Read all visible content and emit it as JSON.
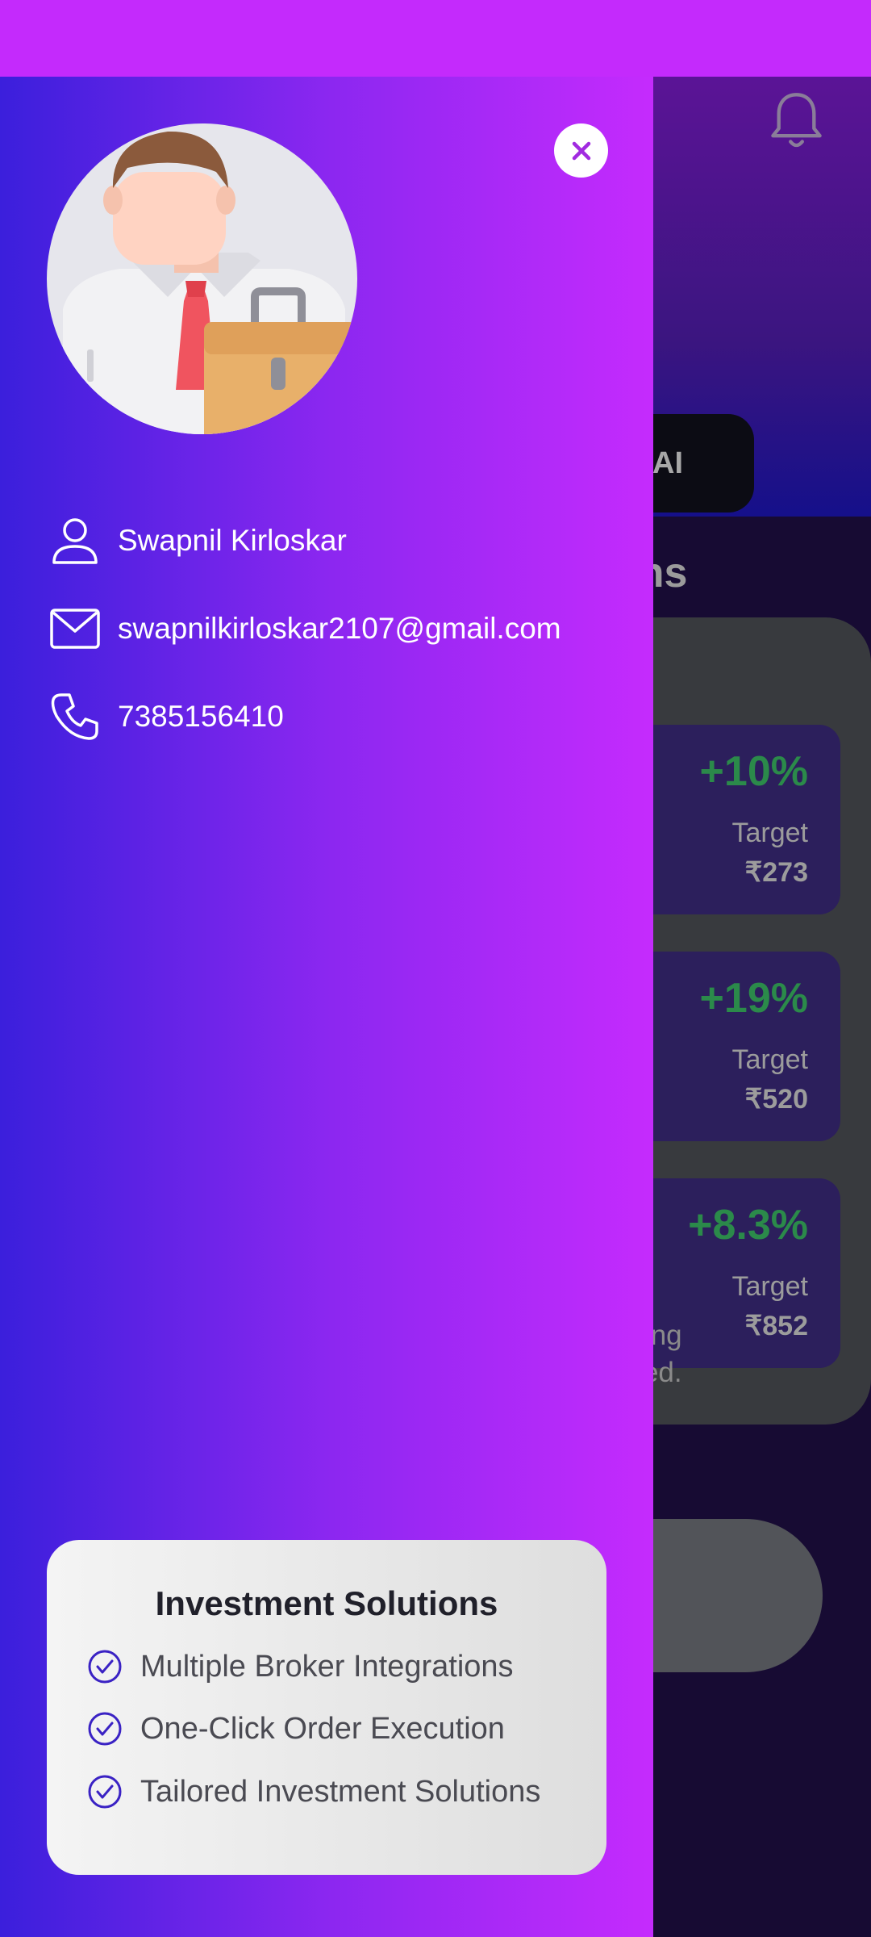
{
  "background_app": {
    "chip_label": "AI",
    "section_title_partial": "ons",
    "cards": [
      {
        "percent": "+10%",
        "target_label": "Target",
        "target_value": "₹273"
      },
      {
        "percent": "+19%",
        "target_label": "Target",
        "target_value": "₹520"
      },
      {
        "percent": "+8.3%",
        "target_label": "Target",
        "target_value": "₹852"
      }
    ],
    "disclaimer_line1": "along",
    "disclaimer_line2": "aced."
  },
  "drawer": {
    "user": {
      "name": "Swapnil Kirloskar",
      "email": "swapnilkirloskar2107@gmail.com",
      "phone": "7385156410"
    },
    "solutions": {
      "title": "Investment Solutions",
      "items": [
        "Multiple Broker Integrations",
        "One-Click Order Execution",
        "Tailored Investment Solutions"
      ]
    }
  },
  "colors": {
    "status_bar": "#c42afc",
    "drawer_gradient_start": "#3b1fdc",
    "drawer_gradient_end": "#c52bfd",
    "positive_green": "#2b8a4a",
    "check_icon": "#3a22c4"
  },
  "icons": [
    "bell-icon",
    "close-icon",
    "user-icon",
    "mail-icon",
    "phone-icon",
    "check-circle-icon"
  ]
}
